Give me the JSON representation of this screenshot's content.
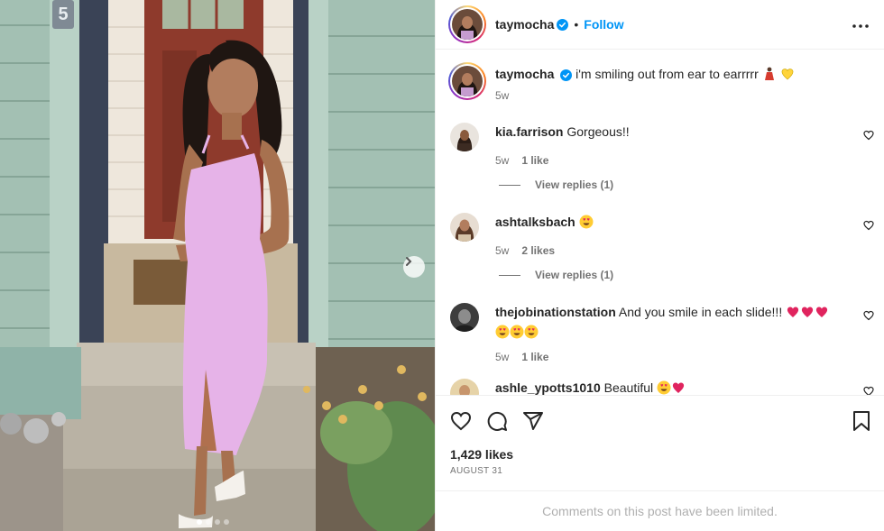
{
  "post": {
    "username": "taymocha",
    "follow_label": "Follow",
    "bullet": "•",
    "caption": "i'm smiling out from ear to earrrrr",
    "caption_age": "5w",
    "house_number": "5",
    "likes": "1,429 likes",
    "date": "AUGUST 31",
    "limited_notice": "Comments on this post have been limited.",
    "slide_count": 4,
    "active_slide": 1
  },
  "comments": [
    {
      "username": "kia.farrison",
      "text": "Gorgeous!!",
      "age": "5w",
      "likes": "1 like",
      "replies": "View replies (1)"
    },
    {
      "username": "ashtalksbach",
      "text": "",
      "age": "5w",
      "likes": "2 likes",
      "replies": "View replies (1)"
    },
    {
      "username": "thejobinationstation",
      "text": "And you smile in each slide!!!",
      "age": "5w",
      "likes": "1 like",
      "replies": ""
    },
    {
      "username": "ashle_ypotts1010",
      "text": "Beautiful",
      "age": "",
      "likes": "",
      "replies": ""
    }
  ],
  "colors": {
    "accent": "#0095f6",
    "verified": "#0095f6",
    "dress": "#e6b3e8",
    "door": "#8e3a2c",
    "siding": "#9fbdb0"
  },
  "icons": [
    "verified-badge-icon",
    "more-options-icon",
    "heart-icon",
    "comment-icon",
    "share-icon",
    "bookmark-icon",
    "chevron-right-icon"
  ]
}
